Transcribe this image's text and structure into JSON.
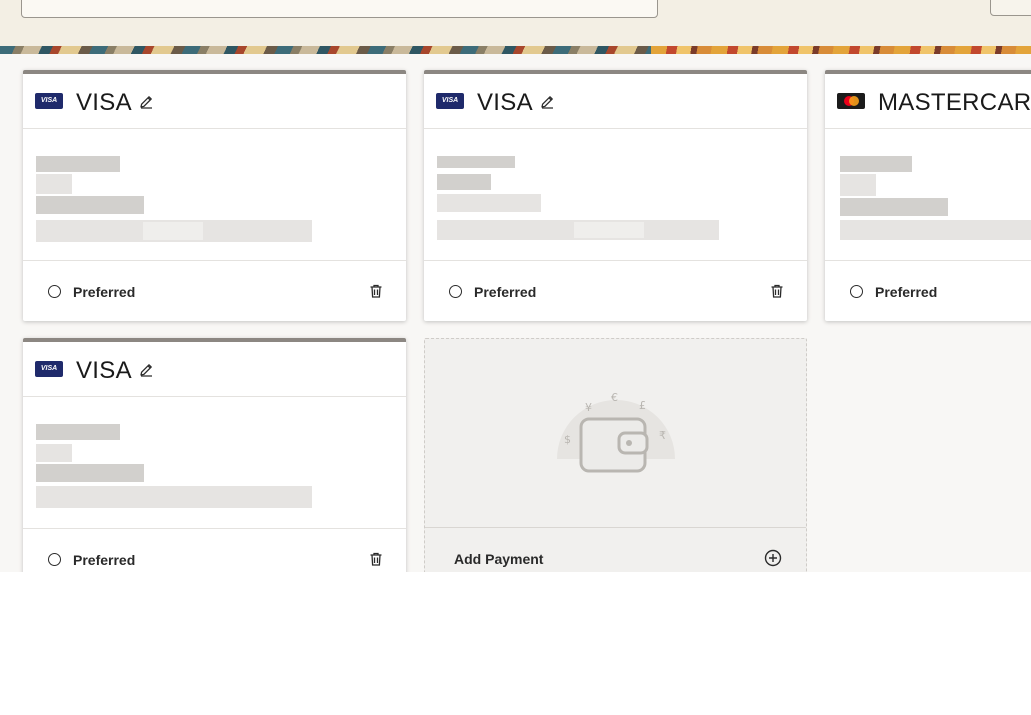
{
  "cards": [
    {
      "brand": "VISA",
      "logo_text": "VISA",
      "preferred_label": "Preferred"
    },
    {
      "brand": "VISA",
      "logo_text": "VISA",
      "preferred_label": "Preferred"
    },
    {
      "brand": "MASTERCARD",
      "logo_text": "",
      "preferred_label": "Preferred"
    },
    {
      "brand": "VISA",
      "logo_text": "VISA",
      "preferred_label": "Preferred"
    }
  ],
  "add_payment": {
    "label": "Add Payment"
  },
  "icons": {
    "edit": "pencil-icon",
    "delete": "trash-icon",
    "preferred": "radio-unchecked",
    "add": "plus-circle-icon",
    "placeholder": "wallet-currency-icon"
  },
  "colors": {
    "visa_logo": "#1f2a6b",
    "card_accent": "#8c8782",
    "mc_red": "#eb001b",
    "mc_orange": "#f79e1b"
  }
}
